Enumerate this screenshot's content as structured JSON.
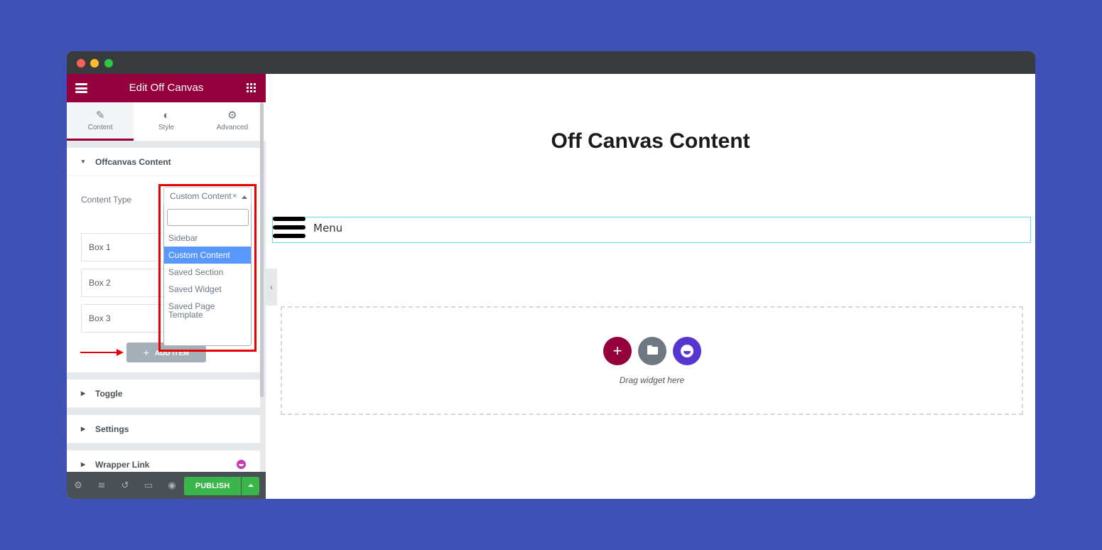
{
  "panel": {
    "title": "Edit Off Canvas",
    "tabs": [
      {
        "label": "Content",
        "icon": "pencil-icon",
        "active": true
      },
      {
        "label": "Style",
        "icon": "contrast-icon",
        "active": false
      },
      {
        "label": "Advanced",
        "icon": "gear-icon",
        "active": false
      }
    ],
    "sections": {
      "offcanvas_content": {
        "title": "Offcanvas Content",
        "expanded": true,
        "content_type_label": "Content Type",
        "content_type_value": "Custom Content",
        "clear_glyph": "×",
        "dropdown": {
          "search_value": "",
          "options": [
            {
              "label": "Sidebar",
              "selected": false
            },
            {
              "label": "Custom Content",
              "selected": true
            },
            {
              "label": "Saved Section",
              "selected": false
            },
            {
              "label": "Saved Widget",
              "selected": false
            },
            {
              "label": "Saved Page Template",
              "selected": false
            }
          ]
        },
        "items": [
          "Box 1",
          "Box 2",
          "Box 3"
        ],
        "add_item_label": "ADD ITEM",
        "add_item_icon": "+"
      },
      "toggle": {
        "title": "Toggle"
      },
      "settings": {
        "title": "Settings"
      },
      "wrapper_link": {
        "title": "Wrapper Link"
      }
    },
    "bottom_bar": {
      "icons": [
        "settings-icon",
        "layers-icon",
        "history-icon",
        "responsive-icon",
        "preview-icon"
      ],
      "publish_label": "PUBLISH"
    }
  },
  "canvas": {
    "collapse_glyph": "‹",
    "heading": "Off Canvas Content",
    "menu_label": "Menu",
    "drop_area": {
      "add_glyph": "+",
      "text": "Drag widget here"
    }
  },
  "colors": {
    "background": "#3f51b5",
    "brand": "#93003c",
    "publish": "#39b54a",
    "selected_option": "#5897fb",
    "annotation": "#e60000"
  }
}
